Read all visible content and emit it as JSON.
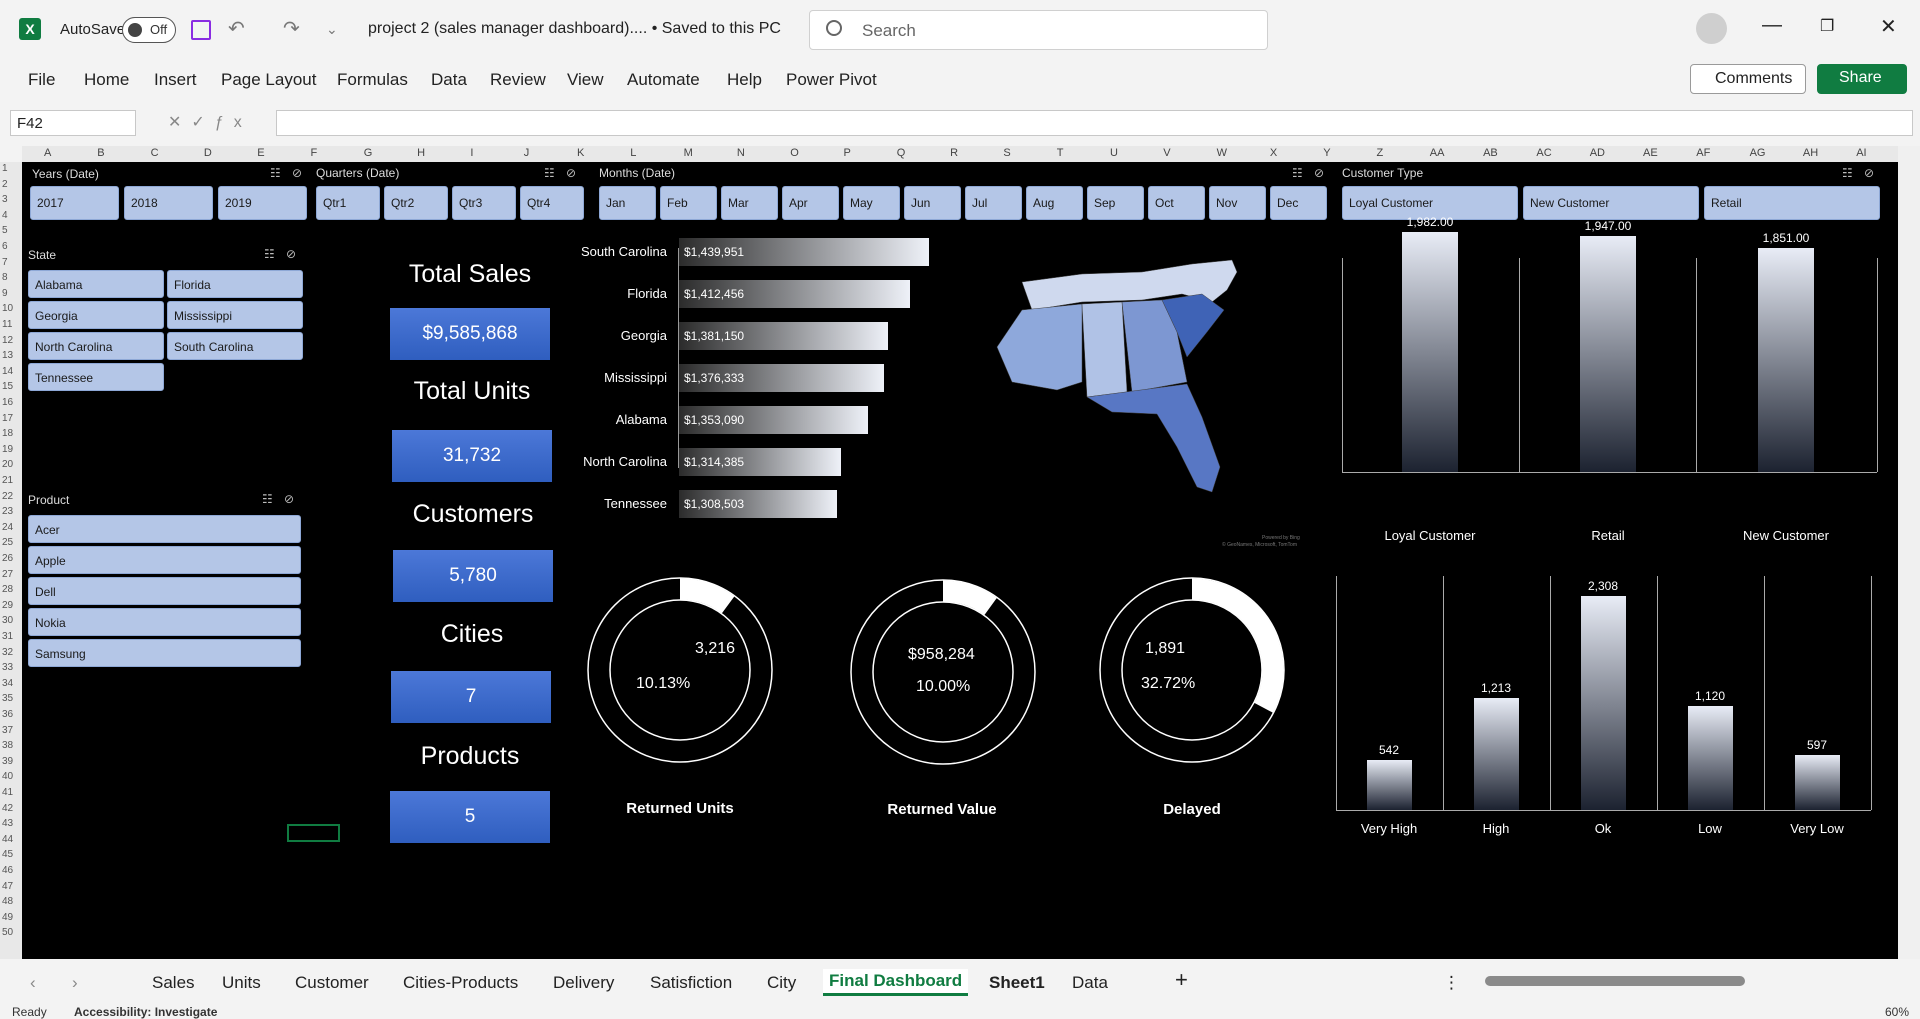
{
  "titlebar": {
    "autosave_label": "AutoSave",
    "autosave_state": "Off",
    "doc_title": "project 2 (sales manager dashboard).... • Saved to this PC",
    "search_placeholder": "Search"
  },
  "menu": [
    "File",
    "Home",
    "Insert",
    "Page Layout",
    "Formulas",
    "Data",
    "Review",
    "View",
    "Automate",
    "Help",
    "Power Pivot"
  ],
  "actions": {
    "comments": "Comments",
    "share": "Share"
  },
  "formula_bar": {
    "name_box": "F42",
    "formula": ""
  },
  "columns": [
    "A",
    "B",
    "C",
    "D",
    "E",
    "F",
    "G",
    "H",
    "I",
    "J",
    "K",
    "L",
    "M",
    "N",
    "O",
    "P",
    "Q",
    "R",
    "S",
    "T",
    "U",
    "V",
    "W",
    "X",
    "Y",
    "Z",
    "AA",
    "AB",
    "AC",
    "AD",
    "AE",
    "AF",
    "AG",
    "AH",
    "AI"
  ],
  "slicers": {
    "years": {
      "title": "Years (Date)",
      "items": [
        "2017",
        "2018",
        "2019"
      ]
    },
    "quarters": {
      "title": "Quarters (Date)",
      "items": [
        "Qtr1",
        "Qtr2",
        "Qtr3",
        "Qtr4"
      ]
    },
    "months": {
      "title": "Months (Date)",
      "items": [
        "Jan",
        "Feb",
        "Mar",
        "Apr",
        "May",
        "Jun",
        "Jul",
        "Aug",
        "Sep",
        "Oct",
        "Nov",
        "Dec"
      ]
    },
    "customer_type": {
      "title": "Customer Type",
      "items": [
        "Loyal Customer",
        "New Customer",
        "Retail"
      ]
    },
    "state": {
      "title": "State",
      "items": [
        "Alabama",
        "Florida",
        "Georgia",
        "Mississippi",
        "North Carolina",
        "South Carolina",
        "Tennessee"
      ]
    },
    "product": {
      "title": "Product",
      "items": [
        "Acer",
        "Apple",
        "Dell",
        "Nokia",
        "Samsung"
      ]
    }
  },
  "kpis": [
    {
      "label": "Total Sales",
      "value": "$9,585,868"
    },
    {
      "label": "Total Units",
      "value": "31,732"
    },
    {
      "label": "Customers",
      "value": "5,780"
    },
    {
      "label": "Cities",
      "value": "7"
    },
    {
      "label": "Products",
      "value": "5"
    }
  ],
  "chart_data": [
    {
      "type": "bar",
      "orientation": "horizontal",
      "categories": [
        "South Carolina",
        "Florida",
        "Georgia",
        "Mississippi",
        "Alabama",
        "North Carolina",
        "Tennessee"
      ],
      "values": [
        1439951,
        1412456,
        1381150,
        1376333,
        1353090,
        1314385,
        1308503
      ],
      "value_labels": [
        "$1,439,951",
        "$1,412,456",
        "$1,381,150",
        "$1,376,333",
        "$1,353,090",
        "$1,314,385",
        "$1,308,503"
      ]
    },
    {
      "type": "bar",
      "categories": [
        "Loyal Customer",
        "Retail",
        "New Customer"
      ],
      "values": [
        1982.0,
        1947.0,
        1851.0
      ],
      "value_labels": [
        "1,982.00",
        "1,947.00",
        "1,851.00"
      ]
    },
    {
      "type": "bar",
      "categories": [
        "Very High",
        "High",
        "Ok",
        "Low",
        "Very Low"
      ],
      "values": [
        542,
        1213,
        2308,
        1120,
        597
      ],
      "value_labels": [
        "542",
        "1,213",
        "2,308",
        "1,120",
        "597"
      ]
    },
    {
      "type": "pie",
      "donuts": [
        {
          "label": "Returned Units",
          "value": "3,216",
          "percent": "10.13%",
          "fraction": 0.1013
        },
        {
          "label": "Returned Value",
          "value": "$958,284",
          "percent": "10.00%",
          "fraction": 0.1
        },
        {
          "label": "Delayed",
          "value": "1,891",
          "percent": "32.72%",
          "fraction": 0.3272
        }
      ]
    }
  ],
  "map": {
    "credit_1": "Powered by Bing",
    "credit_2": "© GeoNames, Microsoft, TomTom"
  },
  "tabs": [
    "Sales",
    "Units",
    "Customer",
    "Cities-Products",
    "Delivery",
    "Satisfiction",
    "City",
    "Final Dashboard",
    "Sheet1",
    "Data"
  ],
  "active_tab": "Final Dashboard",
  "status": {
    "ready": "Ready",
    "accessibility": "Accessibility: Investigate",
    "zoom": "60%"
  },
  "colors": {
    "accent": "#107c41",
    "kpi_blue": "#3c6ad0",
    "chip": "#b4c6e7"
  }
}
